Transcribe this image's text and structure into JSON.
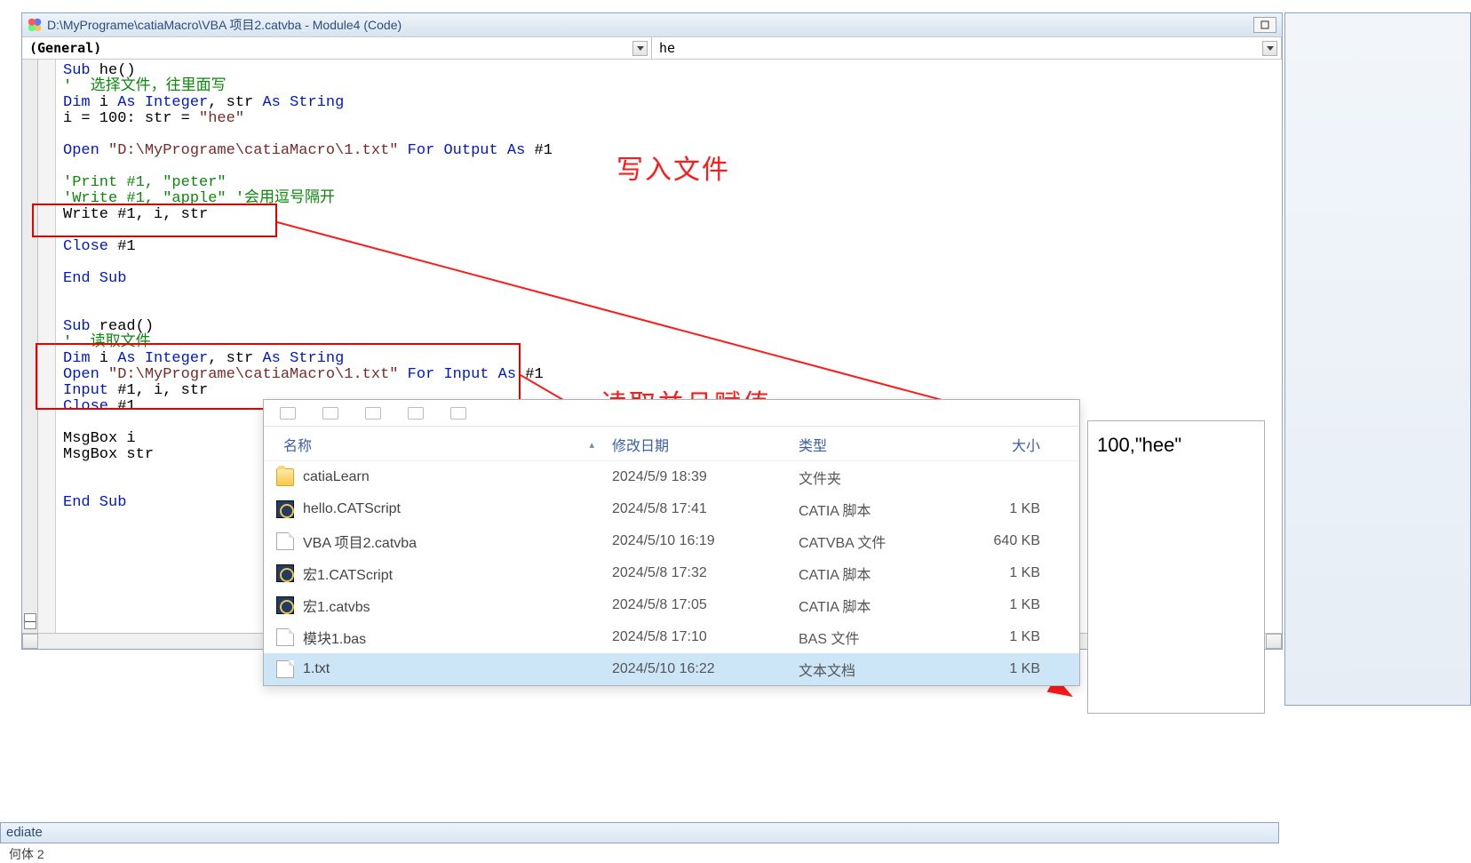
{
  "window": {
    "title": "D:\\MyPrograme\\catiaMacro\\VBA 项目2.catvba - Module4 (Code)"
  },
  "dropdowns": {
    "left": "(General)",
    "right": "he"
  },
  "code": {
    "l1a": "Sub",
    "l1b": " he()",
    "l2": "'  选择文件，往里面写",
    "l3a": "Dim",
    "l3b": " i ",
    "l3c": "As Integer",
    "l3d": ", str ",
    "l3e": "As String",
    "l4a": "i = 100: str = ",
    "l4b": "\"hee\"",
    "l5a": "Open ",
    "l5b": "\"D:\\MyPrograme\\catiaMacro\\1.txt\"",
    "l5c": " For Output As",
    "l5d": " #1",
    "l6": "'Print #1, \"peter\"",
    "l7": "'Write #1, \"apple\" '会用逗号隔开",
    "l8a": "Write #1, i, str",
    "l9a": "Close",
    "l9b": " #1",
    "l10": "End Sub",
    "r1a": "Sub",
    "r1b": " read()",
    "r2": "'  读取文件",
    "r3a": "Dim",
    "r3b": " i ",
    "r3c": "As Integer",
    "r3d": ", str ",
    "r3e": "As String",
    "r4a": "Open ",
    "r4b": "\"D:\\MyPrograme\\catiaMacro\\1.txt\"",
    "r4c": " For Input As",
    "r4d": " #1",
    "r5a": "Input",
    "r5b": " #1, i, str",
    "r6a": "Close",
    "r6b": " #1",
    "r7": "MsgBox i",
    "r8": "MsgBox str",
    "r9": "End Sub"
  },
  "annotations": {
    "write_label": "写入文件",
    "read_label": "读取并且赋值"
  },
  "explorer": {
    "headers": {
      "name": "名称",
      "date": "修改日期",
      "type": "类型",
      "size": "大小"
    },
    "rows": [
      {
        "icon": "folder",
        "name": "catiaLearn",
        "date": "2024/5/9 18:39",
        "type": "文件夹",
        "size": ""
      },
      {
        "icon": "cat",
        "name": "hello.CATScript",
        "date": "2024/5/8 17:41",
        "type": "CATIA 脚本",
        "size": "1 KB"
      },
      {
        "icon": "doc",
        "name": "VBA 项目2.catvba",
        "date": "2024/5/10 16:19",
        "type": "CATVBA 文件",
        "size": "640 KB"
      },
      {
        "icon": "cat",
        "name": "宏1.CATScript",
        "date": "2024/5/8 17:32",
        "type": "CATIA 脚本",
        "size": "1 KB"
      },
      {
        "icon": "cat",
        "name": "宏1.catvbs",
        "date": "2024/5/8 17:05",
        "type": "CATIA 脚本",
        "size": "1 KB"
      },
      {
        "icon": "doc",
        "name": "模块1.bas",
        "date": "2024/5/8 17:10",
        "type": "BAS 文件",
        "size": "1 KB"
      },
      {
        "icon": "doc",
        "name": "1.txt",
        "date": "2024/5/10 16:22",
        "type": "文本文档",
        "size": "1 KB",
        "selected": true
      }
    ]
  },
  "preview": {
    "content": "100,\"hee\""
  },
  "immediate": {
    "label": "ediate"
  },
  "bottom": {
    "left": "何体 2"
  }
}
